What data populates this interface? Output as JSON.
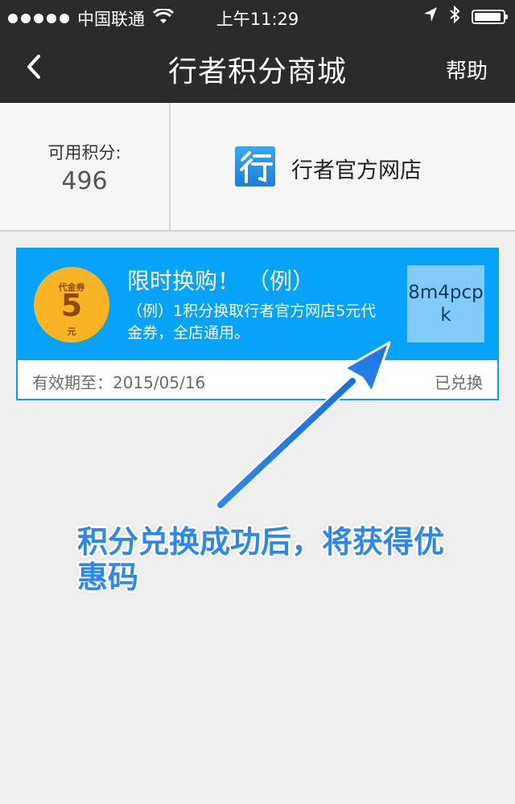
{
  "status_bar": {
    "carrier": "中国联通",
    "time": "上午11:29",
    "signal_dots": 5,
    "icons": [
      "signal-dots-icon",
      "wifi-icon",
      "location-arrow-icon",
      "bluetooth-icon",
      "battery-icon"
    ],
    "battery_level": 0.95
  },
  "nav": {
    "title": "行者积分商城",
    "help_label": "帮助",
    "back_icon": "chevron-left-icon"
  },
  "points": {
    "label": "可用积分:",
    "value": "496"
  },
  "shop": {
    "logo_icon": "xingzhe-logo-icon",
    "name": "行者官方网店"
  },
  "coupon": {
    "badge_top": "代金券",
    "badge_value": "5",
    "badge_unit": "元",
    "title": "限时换购！ （例）",
    "description": "（例）1积分换取行者官方网店5元代金券，全店通用。",
    "code": "8m4pcpk",
    "expiry": "有效期至：2015/05/16",
    "status": "已兑换"
  },
  "annotation": {
    "text": "积分兑换成功后，将获得优惠码",
    "color": "#2f86f0"
  },
  "colors": {
    "nav_bg": "#2b2b2b",
    "coupon_blue": "#07a3fa",
    "code_box": "#80cbf9",
    "badge_orange": "#f8b424"
  }
}
